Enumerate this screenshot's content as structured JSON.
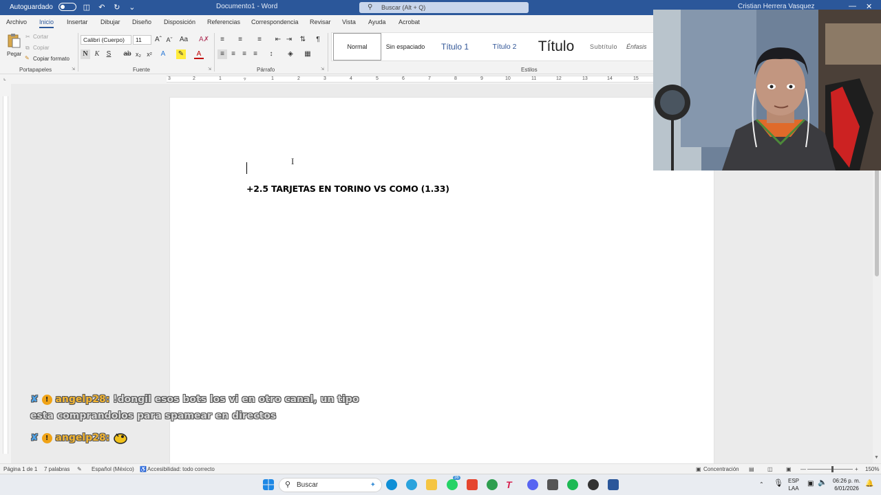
{
  "titlebar": {
    "autosave": "Autoguardado",
    "document": "Documento1 - Word",
    "search": "Buscar (Alt + Q)",
    "user": "Cristian Herrera Vasquez"
  },
  "tabs": [
    "Archivo",
    "Inicio",
    "Insertar",
    "Dibujar",
    "Diseño",
    "Disposición",
    "Referencias",
    "Correspondencia",
    "Revisar",
    "Vista",
    "Ayuda",
    "Acrobat"
  ],
  "active_tab": "Inicio",
  "ribbon": {
    "clipboard": {
      "paste": "Pegar",
      "cut": "Cortar",
      "copy": "Copiar",
      "format_painter": "Copiar formato",
      "group": "Portapapeles"
    },
    "font": {
      "name": "Calibri (Cuerpo)",
      "size": "11",
      "group": "Fuente"
    },
    "paragraph": {
      "group": "Párrafo"
    },
    "styles": {
      "group": "Estilos",
      "items": [
        "Normal",
        "Sin espaciado",
        "Título 1",
        "Título 2",
        "Título",
        "Subtítulo",
        "Énfasis"
      ]
    }
  },
  "ruler_numbers": [
    "3",
    "2",
    "1",
    "1",
    "2",
    "3",
    "4",
    "5",
    "6",
    "7",
    "8",
    "9",
    "10",
    "11",
    "12",
    "13",
    "14",
    "15"
  ],
  "document": {
    "line1": "+2.5 TARJETAS EN TORINO VS COMO (1.33)"
  },
  "chat": [
    {
      "user": "angelp28:",
      "message": "!dongil esos bots los vi en otro canal, un tipo",
      "message_cont": "esta comprandolos para spamear en directos"
    },
    {
      "user": "angelp28:",
      "message": ""
    }
  ],
  "status": {
    "page": "Página 1 de 1",
    "words": "7 palabras",
    "language": "Español (México)",
    "accessibility": "Accesibilidad: todo correcto",
    "focus": "Concentración",
    "zoom": "150%"
  },
  "taskbar": {
    "search": "Buscar",
    "lang": "ESP",
    "region": "LAA",
    "time": "06:26 p. m.",
    "date": "6/01/2026",
    "badge": "36"
  }
}
